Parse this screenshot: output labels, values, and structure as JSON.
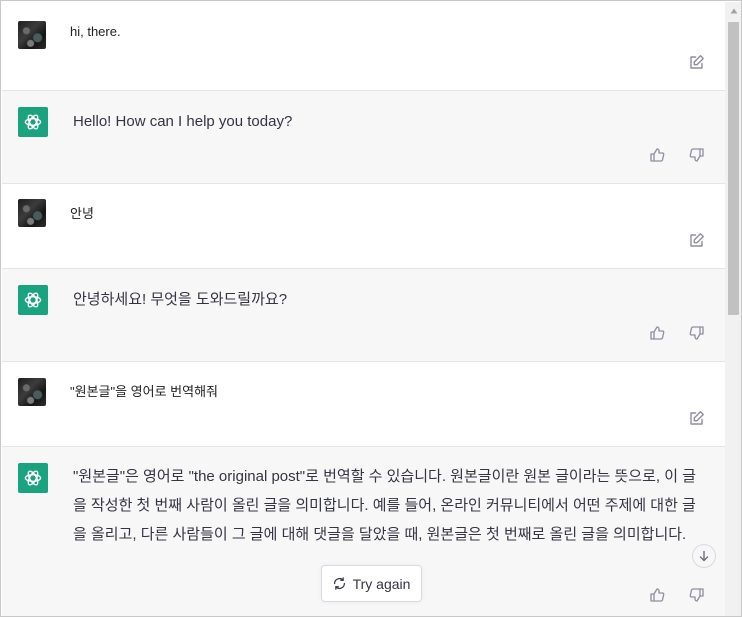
{
  "conversation": {
    "messages": [
      {
        "role": "user",
        "text": "hi, there."
      },
      {
        "role": "assistant",
        "text": "Hello! How can I help you today?"
      },
      {
        "role": "user",
        "text": "안녕"
      },
      {
        "role": "assistant",
        "text": "안녕하세요! 무엇을 도와드릴까요?"
      },
      {
        "role": "user",
        "text": "\"원본글\"을 영어로 번역해줘"
      },
      {
        "role": "assistant",
        "text": "\"원본글\"은 영어로 \"the original post\"로 번역할 수 있습니다. 원본글이란 원본 글이라는 뜻으로, 이 글을 작성한 첫 번째 사람이 올린 글을 의미합니다. 예를 들어, 온라인 커뮤니티에서 어떤 주제에 대한 글을 올리고, 다른 사람들이 그 글에 대해 댓글을 달았을 때, 원본글은 첫 번째로 올린 글을 의미합니다."
      }
    ]
  },
  "actions": {
    "try_again_label": "Try again"
  },
  "colors": {
    "assistant_avatar": "#19a37f",
    "assistant_bg": "#f7f7f8",
    "user_bg": "#ffffff"
  },
  "icons": {
    "edit": "pencil-square-icon",
    "like": "thumbs-up-icon",
    "dislike": "thumbs-down-icon",
    "retry": "refresh-icon",
    "scroll": "arrow-down-icon"
  }
}
